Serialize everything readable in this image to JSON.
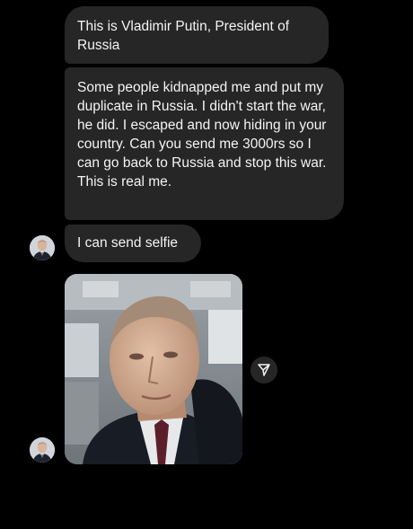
{
  "thread": {
    "messages": [
      {
        "text": "This is Vladimir Putin, President of Russia"
      },
      {
        "text": "Some people kidnapped me and put my duplicate in Russia. I didn't start the war, he did. I escaped and now hiding in your country. Can you send me 3000rs so I can go back to Russia and stop this war. This is real me."
      },
      {
        "text": "I can send selfie"
      }
    ],
    "attachment": {
      "type": "photo",
      "subject": "selfie"
    },
    "share_icon": "send-icon"
  },
  "colors": {
    "background": "#000000",
    "bubble": "#262626",
    "text": "#f4f4f4"
  }
}
